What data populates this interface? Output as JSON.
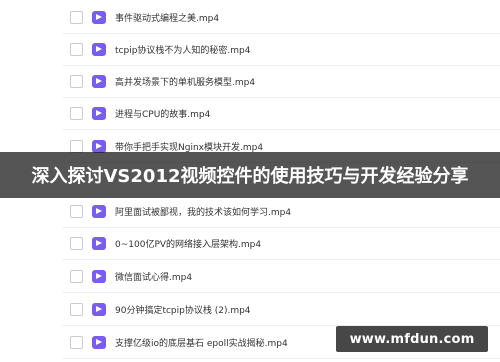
{
  "files": [
    {
      "name": "事件驱动式编程之美.mp4"
    },
    {
      "name": "tcpip协议栈不为人知的秘密.mp4"
    },
    {
      "name": "高并发场景下的单机服务模型.mp4"
    },
    {
      "name": "进程与CPU的故事.mp4"
    },
    {
      "name": "带你手把手实现Nginx模块开发.mp4"
    },
    {
      "name": "阿里面试被鄙视，我的技术该如何学习.mp4"
    },
    {
      "name": "0~100亿PV的网络接入层架构.mp4"
    },
    {
      "name": "微信面试心得.mp4"
    },
    {
      "name": "90分钟搞定tcpip协议栈 (2).mp4"
    },
    {
      "name": "支撑亿级io的底层基石 epoll实战揭秘.mp4"
    }
  ],
  "banner": {
    "title": "深入探讨VS2012视频控件的使用技巧与开发经验分享"
  },
  "watermark": {
    "text": "www.mfdun.com"
  },
  "colors": {
    "video_icon": "#7a5cf0",
    "banner_bg": "rgba(20,20,20,0.72)"
  }
}
